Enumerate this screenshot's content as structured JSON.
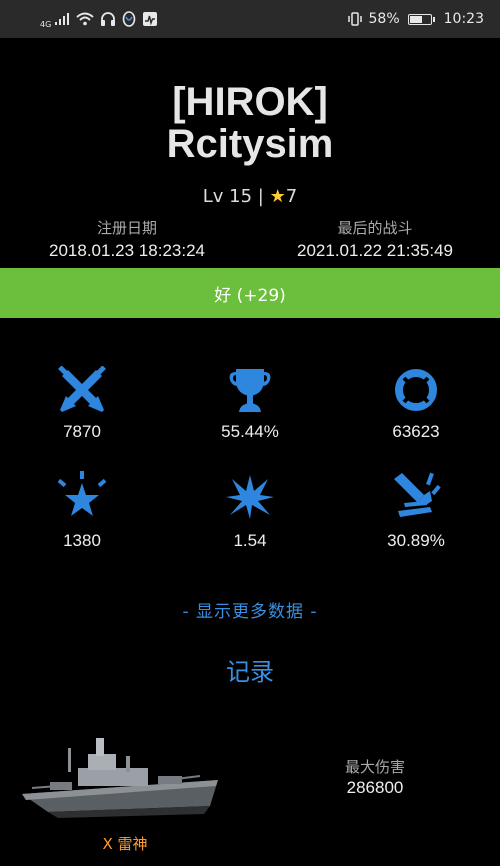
{
  "status_bar": {
    "network": "4G",
    "battery": "58%",
    "time": "10:23",
    "icons": [
      "signal-icon",
      "wifi-icon",
      "headset-icon",
      "app-icon",
      "activity-icon",
      "vibrate-icon",
      "battery-icon"
    ]
  },
  "player": {
    "clan_tag": "[HIROK]",
    "name": "Rcitysim",
    "level_text": "Lv 15 |",
    "star_count": "7"
  },
  "dates": {
    "registered_label": "注册日期",
    "registered_value": "2018.01.23 18:23:24",
    "last_battle_label": "最后的战斗",
    "last_battle_value": "2021.01.22 21:35:49"
  },
  "karma": {
    "text": "好 (+29)",
    "color": "#6bbf3c"
  },
  "stats": [
    {
      "icon": "crossed-swords-icon",
      "value": "7870"
    },
    {
      "icon": "trophy-icon",
      "value": "55.44%"
    },
    {
      "icon": "lifebuoy-icon",
      "value": "63623"
    },
    {
      "icon": "burst-star-icon",
      "value": "1380"
    },
    {
      "icon": "explosion-icon",
      "value": "1.54"
    },
    {
      "icon": "shell-hit-icon",
      "value": "30.89%"
    }
  ],
  "show_more": "- 显示更多数据 -",
  "records": {
    "title": "记录",
    "ship_name": "X 雷神",
    "max_damage_label": "最大伤害",
    "max_damage_value": "286800"
  },
  "colors": {
    "accent": "#3a8fe0",
    "ship_name": "#ff9a2e",
    "star": "#ffcc33"
  }
}
